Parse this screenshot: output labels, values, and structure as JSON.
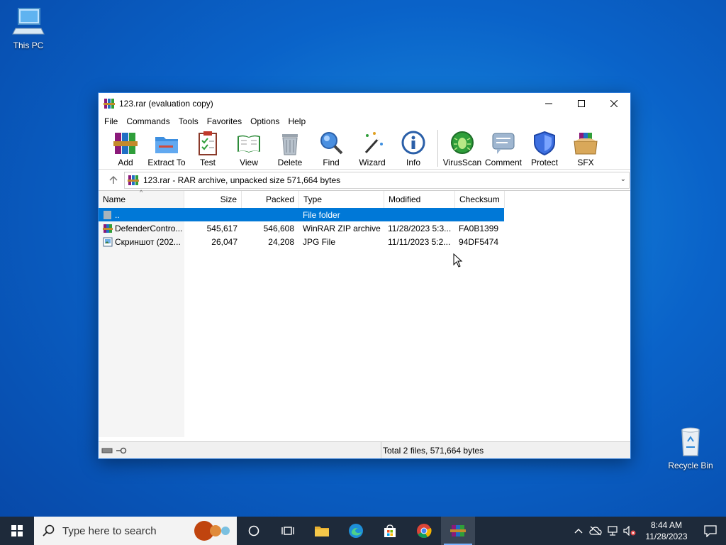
{
  "desktop": {
    "this_pc": "This PC",
    "recycle_bin": "Recycle Bin"
  },
  "window": {
    "title": "123.rar (evaluation copy)",
    "menu": [
      "File",
      "Commands",
      "Tools",
      "Favorites",
      "Options",
      "Help"
    ],
    "toolbar": [
      "Add",
      "Extract To",
      "Test",
      "View",
      "Delete",
      "Find",
      "Wizard",
      "Info",
      "VirusScan",
      "Comment",
      "Protect",
      "SFX"
    ],
    "address": "123.rar - RAR archive, unpacked size 571,664 bytes",
    "columns": {
      "name": "Name",
      "size": "Size",
      "packed": "Packed",
      "type": "Type",
      "modified": "Modified",
      "checksum": "Checksum"
    },
    "rows": [
      {
        "name": "..",
        "size": "",
        "packed": "",
        "type": "File folder",
        "modified": "",
        "checksum": ""
      },
      {
        "name": "DefenderContro...",
        "size": "545,617",
        "packed": "546,608",
        "type": "WinRAR ZIP archive",
        "modified": "11/28/2023 5:3...",
        "checksum": "FA0B1399"
      },
      {
        "name": "Скриншот (202...",
        "size": "26,047",
        "packed": "24,208",
        "type": "JPG File",
        "modified": "11/11/2023 5:2...",
        "checksum": "94DF5474"
      }
    ],
    "status": "Total 2 files, 571,664 bytes"
  },
  "taskbar": {
    "search_placeholder": "Type here to search",
    "time": "8:44 AM",
    "date": "11/28/2023"
  },
  "colors": {
    "selection": "#0078d7",
    "taskbar": "#1e2a3a",
    "desktop": "#0a63c9"
  }
}
